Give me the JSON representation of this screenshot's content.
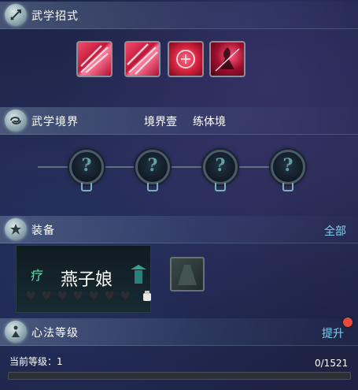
{
  "sections": {
    "skills": {
      "title": "武学招式",
      "icon": "sword-icon"
    },
    "realm": {
      "title": "武学境界",
      "level_name": "境界壹",
      "stage_name": "练体境",
      "icon": "swirl-icon"
    },
    "equipment": {
      "title": "装备",
      "all_label": "全部",
      "icon": "star-badge-icon"
    },
    "mind": {
      "title": "心法等级",
      "upgrade_label": "提升",
      "icon": "meditating-figure-icon"
    }
  },
  "skills": [
    {
      "name": "slash-skill-1"
    },
    {
      "name": "slash-skill-2"
    },
    {
      "name": "seal-skill"
    },
    {
      "name": "figure-skill"
    }
  ],
  "realm_nodes": [
    {
      "symbol": "?"
    },
    {
      "symbol": "?"
    },
    {
      "symbol": "?"
    },
    {
      "symbol": "?"
    }
  ],
  "equipment": {
    "badge": "疗",
    "name": "燕子娘",
    "hearts": 7
  },
  "mind": {
    "current_level_label": "当前等级：1",
    "progress_text": "0/1521",
    "progress": 0
  },
  "colors": {
    "accent": "#7fd0f0",
    "teal": "#5fc0a0",
    "skill_red": "#e0284a",
    "badge_red": "#e84a3a"
  }
}
